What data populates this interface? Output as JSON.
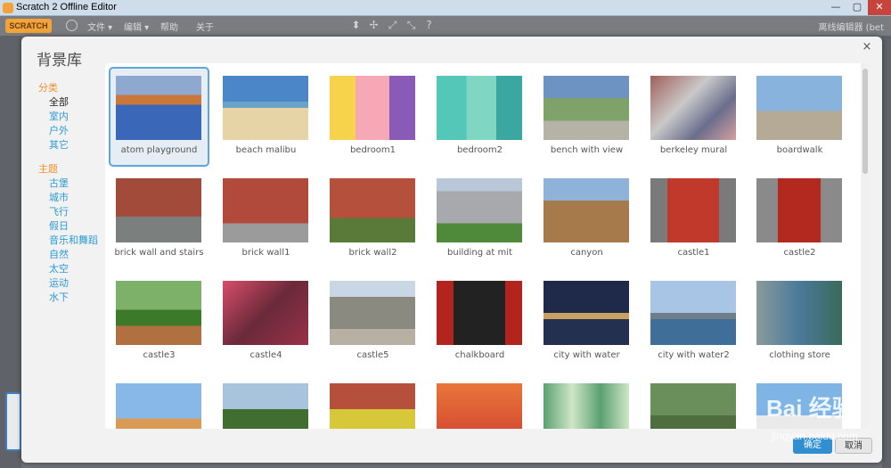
{
  "window": {
    "title": "Scratch 2 Offline Editor",
    "min": "—",
    "max": "▢",
    "close": "✕"
  },
  "menubar": {
    "logo": "SCRATCH",
    "file": "文件 ▾",
    "edit": "编辑 ▾",
    "help": "帮助",
    "about": "关于",
    "right_label": "离线编辑器 (bet"
  },
  "dialog": {
    "title": "背景库",
    "close": "×",
    "category_heading": "分类",
    "categories": [
      "全部",
      "室内",
      "户外",
      "其它"
    ],
    "theme_heading": "主题",
    "themes": [
      "古堡",
      "城市",
      "飞行",
      "假日",
      "音乐和舞蹈",
      "自然",
      "太空",
      "运动",
      "水下"
    ],
    "ok_label": "确定",
    "cancel_label": "取消"
  },
  "backdrops": [
    "atom playground",
    "beach malibu",
    "bedroom1",
    "bedroom2",
    "bench with view",
    "berkeley mural",
    "boardwalk",
    "brick wall and stairs",
    "brick wall1",
    "brick wall2",
    "building at mit",
    "canyon",
    "castle1",
    "castle2",
    "castle3",
    "castle4",
    "castle5",
    "chalkboard",
    "city with water",
    "city with water2",
    "clothing store",
    "",
    "",
    "",
    "",
    "",
    "",
    ""
  ],
  "selected_index": 0,
  "watermark": {
    "main": "Bai 经验",
    "sub": "jingyan.baidu.com"
  }
}
